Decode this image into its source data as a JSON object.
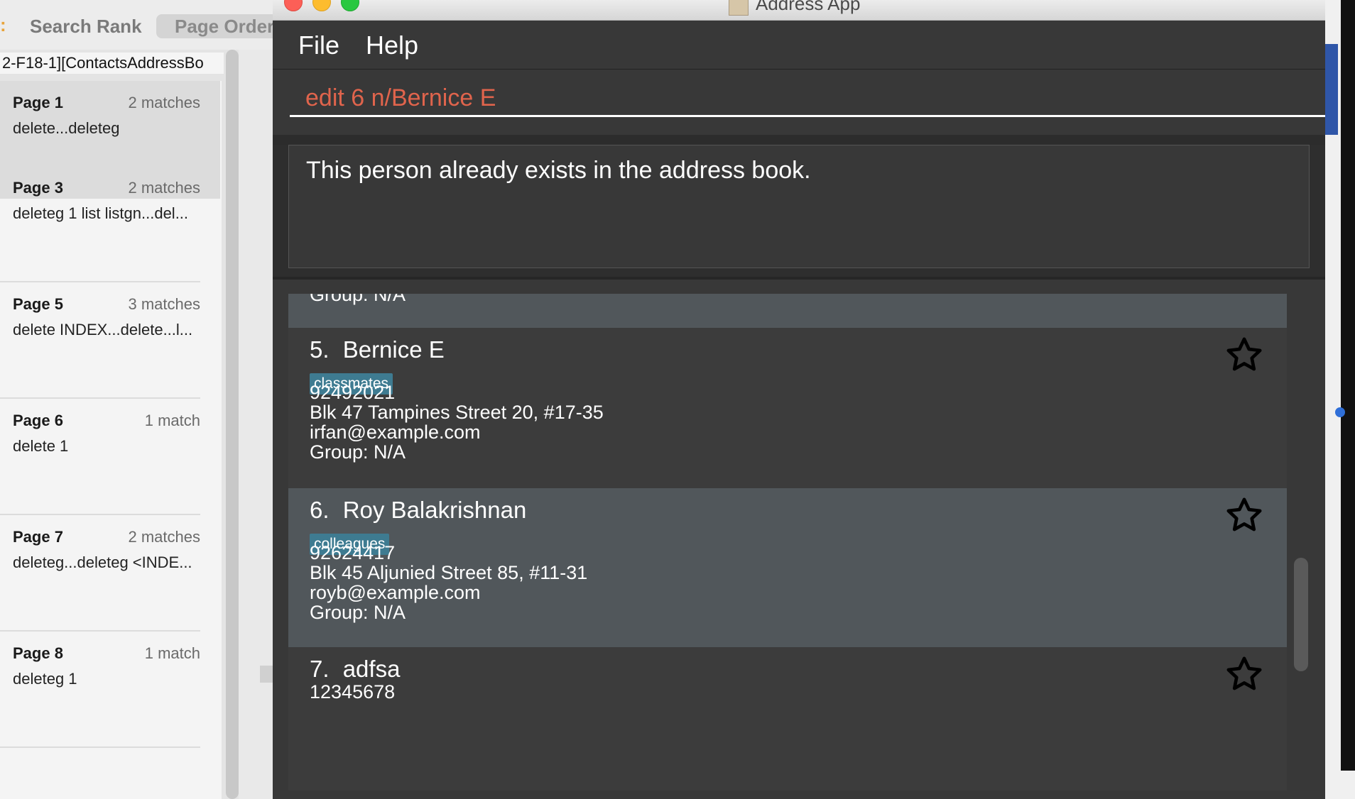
{
  "left_panel": {
    "marker": ":",
    "tabs": [
      {
        "label": "Search Rank"
      },
      {
        "label": "Page Order"
      }
    ],
    "document_name": "2-F18-1][ContactsAddressBo",
    "results": [
      {
        "page": "Page 1",
        "matches": "2 matches",
        "snippet": "delete...deleteg",
        "selected": true
      },
      {
        "page": "Page 3",
        "matches": "2 matches",
        "snippet": "deleteg 1 list listgn...del..."
      },
      {
        "page": "Page 5",
        "matches": "3 matches",
        "snippet": "delete INDEX...delete...l..."
      },
      {
        "page": "Page 6",
        "matches": "1 match",
        "snippet": "delete 1"
      },
      {
        "page": "Page 7",
        "matches": "2 matches",
        "snippet": "deleteg...deleteg <INDE..."
      },
      {
        "page": "Page 8",
        "matches": "1 match",
        "snippet": "deleteg 1"
      }
    ]
  },
  "app": {
    "title": "Address App",
    "menu": {
      "file": "File",
      "help": "Help"
    },
    "command_input": "edit 6 n/Bernice E",
    "result_message": "This person already exists in the address book.",
    "partial_prev_card": {
      "group": "Group: N/A"
    },
    "persons": [
      {
        "index": "5.",
        "name": "Bernice E",
        "tag": "classmates",
        "phone": "92492021",
        "address": "Blk 47 Tampines Street 20, #17-35",
        "email": "irfan@example.com",
        "group": "Group: N/A"
      },
      {
        "index": "6.",
        "name": "Roy Balakrishnan",
        "tag": "colleagues",
        "phone": "92624417",
        "address": "Blk 45 Aljunied Street 85, #11-31",
        "email": "royb@example.com",
        "group": "Group: N/A"
      },
      {
        "index": "7.",
        "name": "adfsa",
        "phone": "12345678"
      }
    ],
    "colors": {
      "command_text": "#e0644c",
      "tag_bg": "#3e7b91",
      "card_selected_bg": "#51575b",
      "card_bg": "#3c3c3c"
    },
    "icons": {
      "favourite": "star-outline-icon"
    }
  }
}
